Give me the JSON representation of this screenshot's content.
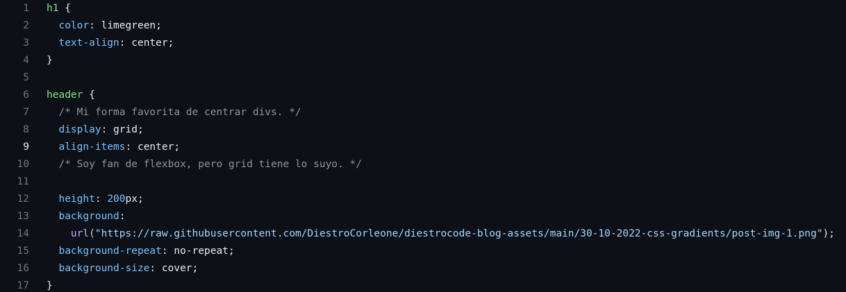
{
  "editor": {
    "active_line": 9,
    "lines": [
      {
        "num": "1",
        "sel": "h1",
        "rest": " {"
      },
      {
        "num": "2",
        "indent": "  ",
        "prop": "color",
        "rest": ": limegreen;"
      },
      {
        "num": "3",
        "indent": "  ",
        "prop": "text-align",
        "rest": ": center;"
      },
      {
        "num": "4",
        "rest": "}"
      },
      {
        "num": "5",
        "rest": ""
      },
      {
        "num": "6",
        "sel": "header",
        "rest": " {"
      },
      {
        "num": "7",
        "indent": "  ",
        "comment": "/* Mi forma favorita de centrar divs. */"
      },
      {
        "num": "8",
        "indent": "  ",
        "prop": "display",
        "rest": ": grid;"
      },
      {
        "num": "9",
        "indent": "  ",
        "prop": "align-items",
        "rest": ": center;"
      },
      {
        "num": "10",
        "indent": "  ",
        "comment": "/* Soy fan de flexbox, pero grid tiene lo suyo. */"
      },
      {
        "num": "11",
        "rest": ""
      },
      {
        "num": "12",
        "indent": "  ",
        "prop": "height",
        "mid": ": ",
        "number": "200",
        "rest": "px;"
      },
      {
        "num": "13",
        "indent": "  ",
        "prop": "background",
        "rest": ":"
      },
      {
        "num": "14",
        "indent": "    ",
        "fn": "url",
        "open": "(",
        "string": "\"https://raw.githubusercontent.com/DiestroCorleone/diestrocode-blog-assets/main/30-10-2022-css-gradients/post-img-1.png\"",
        "rest": ");"
      },
      {
        "num": "15",
        "indent": "  ",
        "prop": "background-repeat",
        "rest": ": no-repeat;"
      },
      {
        "num": "16",
        "indent": "  ",
        "prop": "background-size",
        "rest": ": cover;"
      },
      {
        "num": "17",
        "rest": "}"
      }
    ]
  },
  "colors": {
    "background": "#0d1117",
    "selector": "#7ee787",
    "property": "#79c0ff",
    "comment": "#8b949e",
    "function": "#d2a8ff",
    "string": "#a5d6ff"
  }
}
